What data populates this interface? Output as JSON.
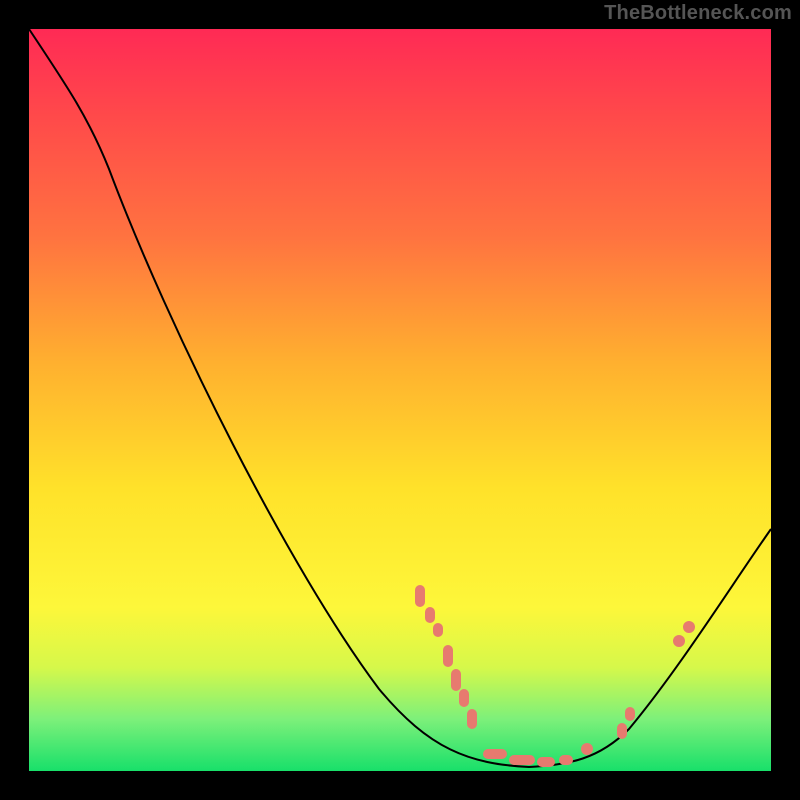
{
  "watermark": "TheBottleneck.com",
  "chart_data": {
    "type": "line",
    "title": "",
    "xlabel": "",
    "ylabel": "",
    "xlim": [
      0,
      100
    ],
    "ylim": [
      0,
      100
    ],
    "grid": false,
    "legend": false,
    "background_gradient": {
      "direction": "vertical",
      "stops": [
        {
          "pos": 0.0,
          "color": "#ff2a55"
        },
        {
          "pos": 0.28,
          "color": "#ff7340"
        },
        {
          "pos": 0.62,
          "color": "#ffe22a"
        },
        {
          "pos": 0.86,
          "color": "#d6f84a"
        },
        {
          "pos": 1.0,
          "color": "#18e06a"
        }
      ]
    },
    "series": [
      {
        "name": "bottleneck-curve",
        "color": "#000000",
        "x": [
          0,
          5,
          11,
          19,
          27,
          35,
          43,
          50,
          56,
          62,
          67,
          72,
          77,
          81,
          85,
          90,
          95,
          100
        ],
        "values": [
          100,
          93,
          81,
          65,
          50,
          38,
          27,
          17,
          10,
          5,
          2,
          1,
          2,
          6,
          12,
          21,
          28,
          33
        ]
      }
    ],
    "markers": {
      "name": "highlighted-points",
      "color": "#e77a6f",
      "x": [
        52,
        53,
        55,
        56,
        57,
        58,
        59,
        62,
        65,
        68,
        71,
        73,
        75,
        79,
        80,
        88,
        89
      ],
      "values": [
        25,
        22,
        20,
        17,
        14,
        11,
        8,
        4,
        3,
        2,
        2,
        2,
        3,
        6,
        8,
        18,
        20
      ]
    }
  }
}
